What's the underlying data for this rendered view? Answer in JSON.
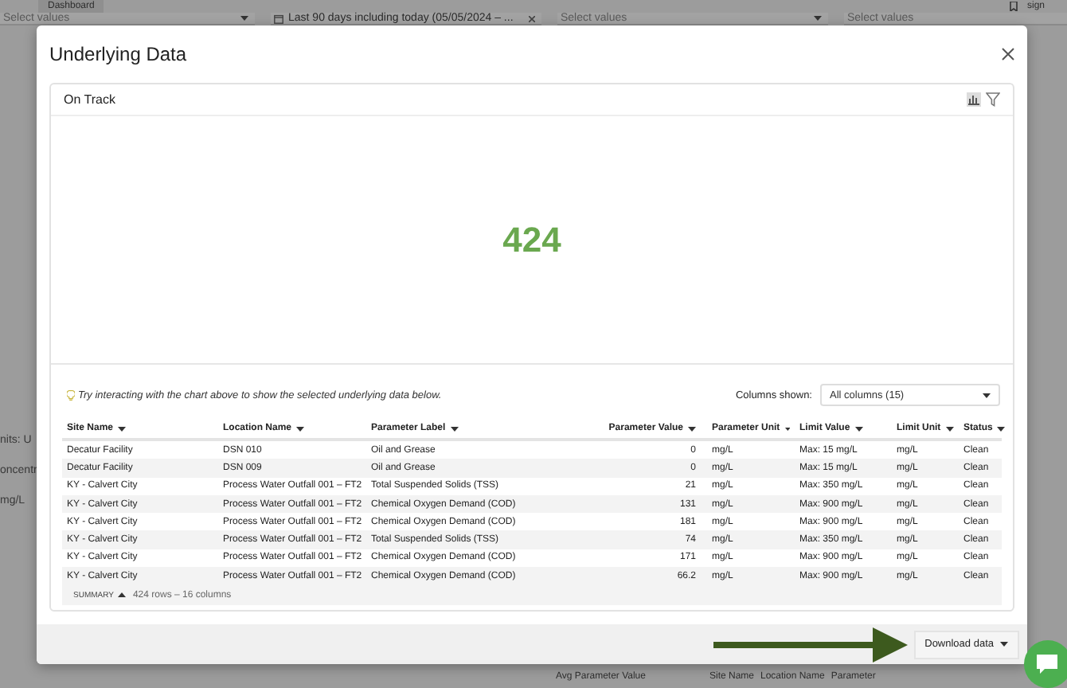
{
  "background": {
    "dashboard_tab": "Dashboard",
    "account_text": "sign",
    "filters": [
      {
        "kind": "select",
        "text": "Select values"
      },
      {
        "kind": "date",
        "text": "Last 90 days including today (05/05/2024 – ..."
      },
      {
        "kind": "select",
        "text": "Select values"
      },
      {
        "kind": "select",
        "text": "Select values"
      }
    ],
    "side_texts": [
      "nits: U",
      "oncentr",
      "mg/L"
    ],
    "bottom_labels": {
      "measure": "Avg Parameter Value",
      "breadcrumbs": [
        "Site Name",
        "Location Name",
        "Parameter"
      ]
    }
  },
  "modal": {
    "title": "Underlying Data",
    "card": {
      "title": "On Track",
      "value": "424",
      "hint": "Try interacting with the chart above to show the selected underlying data below.",
      "columns_shown_label": "Columns shown:",
      "columns_shown_value": "All columns (15)",
      "table": {
        "columns": [
          {
            "label": "Site Name"
          },
          {
            "label": "Location Name"
          },
          {
            "label": "Parameter Label"
          },
          {
            "label": "Parameter Value"
          },
          {
            "label": "Parameter Unit"
          },
          {
            "label": "Limit Value"
          },
          {
            "label": "Limit Unit"
          },
          {
            "label": "Status"
          }
        ],
        "rows": [
          [
            "Decatur Facility",
            "DSN 010",
            "Oil and Grease",
            "0",
            "mg/L",
            "Max: 15 mg/L",
            "mg/L",
            "Clean"
          ],
          [
            "Decatur Facility",
            "DSN 009",
            "Oil and Grease",
            "0",
            "mg/L",
            "Max: 15 mg/L",
            "mg/L",
            "Clean"
          ],
          [
            "KY - Calvert City",
            "Process Water Outfall 001 – FT2",
            "Total Suspended Solids (TSS)",
            "21",
            "mg/L",
            "Max: 350 mg/L",
            "mg/L",
            "Clean"
          ],
          [
            "KY - Calvert City",
            "Process Water Outfall 001 – FT2",
            "Chemical Oxygen Demand (COD)",
            "131",
            "mg/L",
            "Max: 900 mg/L",
            "mg/L",
            "Clean"
          ],
          [
            "KY - Calvert City",
            "Process Water Outfall 001 – FT2",
            "Chemical Oxygen Demand (COD)",
            "181",
            "mg/L",
            "Max: 900 mg/L",
            "mg/L",
            "Clean"
          ],
          [
            "KY - Calvert City",
            "Process Water Outfall 001 – FT2",
            "Total Suspended Solids (TSS)",
            "74",
            "mg/L",
            "Max: 350 mg/L",
            "mg/L",
            "Clean"
          ],
          [
            "KY - Calvert City",
            "Process Water Outfall 001 – FT2",
            "Chemical Oxygen Demand (COD)",
            "171",
            "mg/L",
            "Max: 900 mg/L",
            "mg/L",
            "Clean"
          ],
          [
            "KY - Calvert City",
            "Process Water Outfall 001 – FT2",
            "Chemical Oxygen Demand (COD)",
            "66.2",
            "mg/L",
            "Max: 900 mg/L",
            "mg/L",
            "Clean"
          ]
        ]
      },
      "summary": {
        "label": "SUMMARY",
        "text": "424 rows – 16 columns"
      }
    },
    "download_button": "Download data"
  }
}
